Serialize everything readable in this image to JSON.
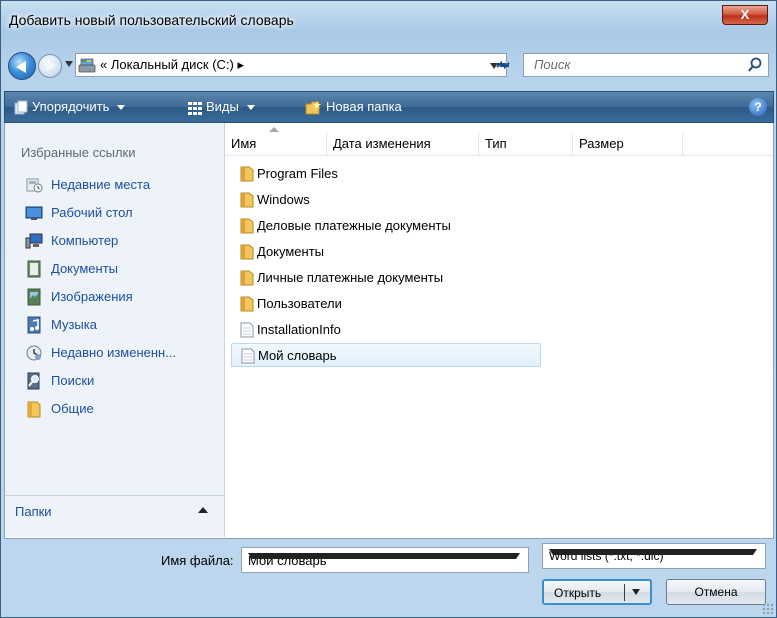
{
  "window": {
    "title": "Добавить новый пользовательский словарь",
    "close_label": "X"
  },
  "navbar": {
    "breadcrumb": "« Локальный диск (C:) ▸",
    "search_placeholder": "Поиск"
  },
  "toolbar": {
    "organize_label": "Упорядочить",
    "views_label": "Виды",
    "new_folder_label": "Новая папка",
    "help_label": "?"
  },
  "sidebar": {
    "title": "Избранные ссылки",
    "items": [
      {
        "label": "Недавние места",
        "icon": "recent-places-icon"
      },
      {
        "label": "Рабочий стол",
        "icon": "desktop-icon"
      },
      {
        "label": "Компьютер",
        "icon": "computer-icon"
      },
      {
        "label": "Документы",
        "icon": "documents-icon"
      },
      {
        "label": "Изображения",
        "icon": "pictures-icon"
      },
      {
        "label": "Музыка",
        "icon": "music-icon"
      },
      {
        "label": "Недавно измененн...",
        "icon": "recently-changed-icon"
      },
      {
        "label": "Поиски",
        "icon": "searches-icon"
      },
      {
        "label": "Общие",
        "icon": "public-icon"
      }
    ],
    "folders_label": "Папки"
  },
  "columns": {
    "name": "Имя",
    "date": "Дата изменения",
    "type": "Тип",
    "size": "Размер"
  },
  "files": [
    {
      "name": "Program Files",
      "kind": "folder"
    },
    {
      "name": "Windows",
      "kind": "folder"
    },
    {
      "name": "Деловые платежные документы",
      "kind": "folder"
    },
    {
      "name": "Документы",
      "kind": "folder"
    },
    {
      "name": "Личные платежные документы",
      "kind": "folder"
    },
    {
      "name": "Пользователи",
      "kind": "folder"
    },
    {
      "name": "InstallationInfo",
      "kind": "file"
    },
    {
      "name": "Мой словарь",
      "kind": "file",
      "selected": true
    }
  ],
  "bottom": {
    "filename_label": "Имя файла:",
    "filename_value": "Мой словарь",
    "filetype_value": "Word lists (*.txt, *.dic)",
    "open_label": "Открыть",
    "cancel_label": "Отмена"
  },
  "colors": {
    "accent": "#1e4fa0",
    "toolbar": "#3e6a96",
    "folder": "#e8b64a"
  }
}
